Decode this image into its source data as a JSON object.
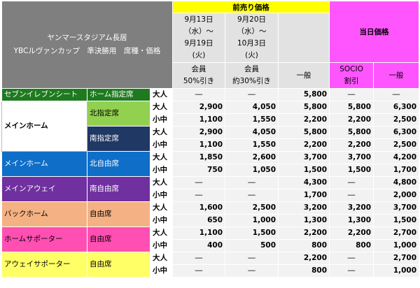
{
  "header": {
    "title_line1": "ヤンマースタジアム長居",
    "title_line2": "YBCルヴァンカップ　準決勝用　席種・価格",
    "presale": "前売り価格",
    "dayof": "当日価格",
    "period1": [
      "9月13日",
      "（水）～",
      "9月19日",
      "(火)"
    ],
    "period2": [
      "9月20日",
      "（水）～",
      "10月3日",
      "(火)"
    ],
    "sub1": [
      "会員",
      "50%引き"
    ],
    "sub2": [
      "会員",
      "約30%引き"
    ],
    "sub3": "一般",
    "sub4": [
      "SOCIO",
      "割引"
    ],
    "sub5": "一般"
  },
  "colors": {
    "seven": "#1f7a1f",
    "green": "#92d050",
    "navy": "#1f3864",
    "blue": "#0f6ec8",
    "purple": "#7030a0",
    "orange": "#f4b183",
    "pink": "#ff4fb3",
    "yellow": "#ffff66"
  },
  "sections": [
    {
      "name": "セブンイレブンシート",
      "color": "#1f7a1f",
      "text": "#ffffff",
      "seats": [
        {
          "seat": "ホーム指定席",
          "color": "#1f7a1f",
          "text": "#ffffff",
          "rows": [
            {
              "age": "大人",
              "v": [
                "―",
                "―",
                "5,800",
                "―",
                "―"
              ]
            }
          ]
        }
      ]
    },
    {
      "name": "メインホーム",
      "color": "#ffffff",
      "text": "#000000",
      "seats": [
        {
          "seat": "北指定席",
          "color": "#92d050",
          "text": "#000000",
          "rows": [
            {
              "age": "大人",
              "v": [
                "2,900",
                "4,050",
                "5,800",
                "5,800",
                "6,300"
              ]
            },
            {
              "age": "小中",
              "v": [
                "1,100",
                "1,550",
                "2,200",
                "2,200",
                "2,500"
              ]
            }
          ]
        },
        {
          "seat": "南指定席",
          "color": "#1f3864",
          "text": "#ffffff",
          "rows": [
            {
              "age": "大人",
              "v": [
                "2,900",
                "4,050",
                "5,800",
                "5,800",
                "6,300"
              ]
            },
            {
              "age": "小中",
              "v": [
                "1,100",
                "1,550",
                "2,200",
                "2,200",
                "2,500"
              ]
            }
          ]
        }
      ]
    },
    {
      "name": "メインホーム",
      "color": "#0f6ec8",
      "text": "#ffffff",
      "seats": [
        {
          "seat": "北自由席",
          "color": "#0f6ec8",
          "text": "#ffffff",
          "rows": [
            {
              "age": "大人",
              "v": [
                "1,850",
                "2,600",
                "3,700",
                "3,700",
                "4,200"
              ]
            },
            {
              "age": "小中",
              "v": [
                "750",
                "1,050",
                "1,500",
                "1,500",
                "1,700"
              ]
            }
          ]
        }
      ]
    },
    {
      "name": "メインアウェイ",
      "color": "#7030a0",
      "text": "#ffffff",
      "seats": [
        {
          "seat": "南自由席",
          "color": "#7030a0",
          "text": "#ffffff",
          "rows": [
            {
              "age": "大人",
              "v": [
                "―",
                "―",
                "4,300",
                "―",
                "4,800"
              ]
            },
            {
              "age": "小中",
              "v": [
                "―",
                "―",
                "1,700",
                "―",
                "2,000"
              ]
            }
          ]
        }
      ]
    },
    {
      "name": "バックホーム",
      "color": "#f4b183",
      "text": "#000000",
      "seats": [
        {
          "seat": "自由席",
          "color": "#f4b183",
          "text": "#000000",
          "rows": [
            {
              "age": "大人",
              "v": [
                "1,600",
                "2,500",
                "3,200",
                "3,200",
                "3,700"
              ]
            },
            {
              "age": "小中",
              "v": [
                "650",
                "1,000",
                "1,300",
                "1,300",
                "1,500"
              ]
            }
          ]
        }
      ]
    },
    {
      "name": "ホームサポーター",
      "color": "#ff4fb3",
      "text": "#000000",
      "seats": [
        {
          "seat": "自由席",
          "color": "#ff4fb3",
          "text": "#000000",
          "rows": [
            {
              "age": "大人",
              "v": [
                "1,100",
                "1,500",
                "2,200",
                "2,200",
                "2,700"
              ]
            },
            {
              "age": "小中",
              "v": [
                "400",
                "500",
                "800",
                "800",
                "1,000"
              ]
            }
          ]
        }
      ]
    },
    {
      "name": "アウェイサポーター",
      "color": "#ffff66",
      "text": "#000000",
      "seats": [
        {
          "seat": "自由席",
          "color": "#ffff66",
          "text": "#000000",
          "rows": [
            {
              "age": "大人",
              "v": [
                "―",
                "―",
                "2,200",
                "―",
                "2,700"
              ]
            },
            {
              "age": "小中",
              "v": [
                "―",
                "―",
                "800",
                "―",
                "1,000"
              ]
            }
          ]
        }
      ]
    }
  ]
}
